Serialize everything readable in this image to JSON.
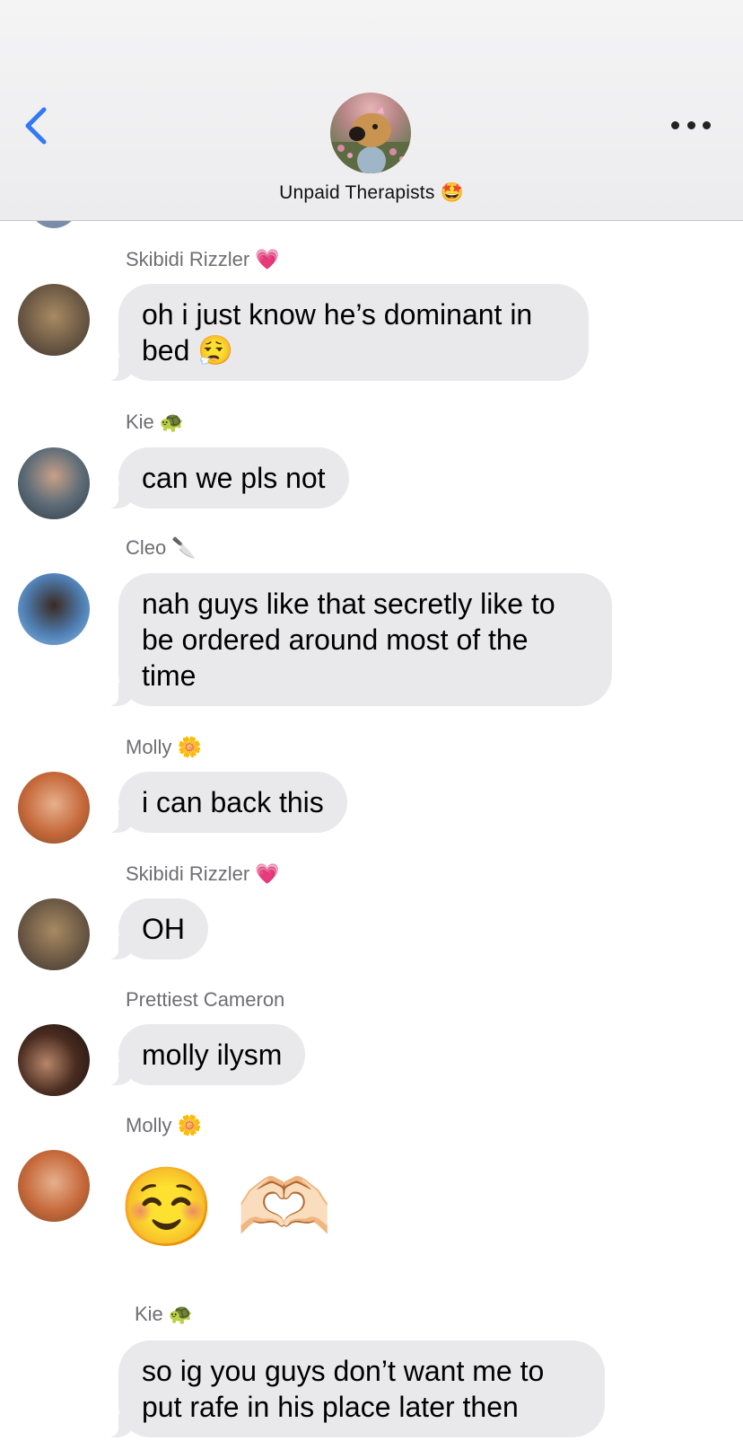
{
  "header": {
    "title": "Unpaid Therapists 🤩"
  },
  "icons": {
    "back": "chevron-left-icon",
    "more": "ellipsis-icon"
  },
  "colors": {
    "accent": "#3478f6",
    "bubble": "#e9e9eb",
    "sender": "#6e6e73"
  },
  "messages": [
    {
      "sender": "Skibidi Rizzler 💗",
      "text": "oh i just know he’s dominant in bed 😮‍💨"
    },
    {
      "sender": "Kie 🐢",
      "text": "can we pls not"
    },
    {
      "sender": "Cleo 🔪",
      "text": "nah guys like that secretly like to be ordered around most of the time"
    },
    {
      "sender": "Molly 🌼",
      "text": "i can back this"
    },
    {
      "sender": "Skibidi Rizzler 💗",
      "text": "OH"
    },
    {
      "sender": "Prettiest Cameron",
      "text": "molly ilysm"
    },
    {
      "sender": "Molly 🌼",
      "text": "☺️ 🫶🏻"
    },
    {
      "sender": "Kie 🐢",
      "text": "so ig you guys don’t want me to put rafe in his place later then"
    }
  ]
}
